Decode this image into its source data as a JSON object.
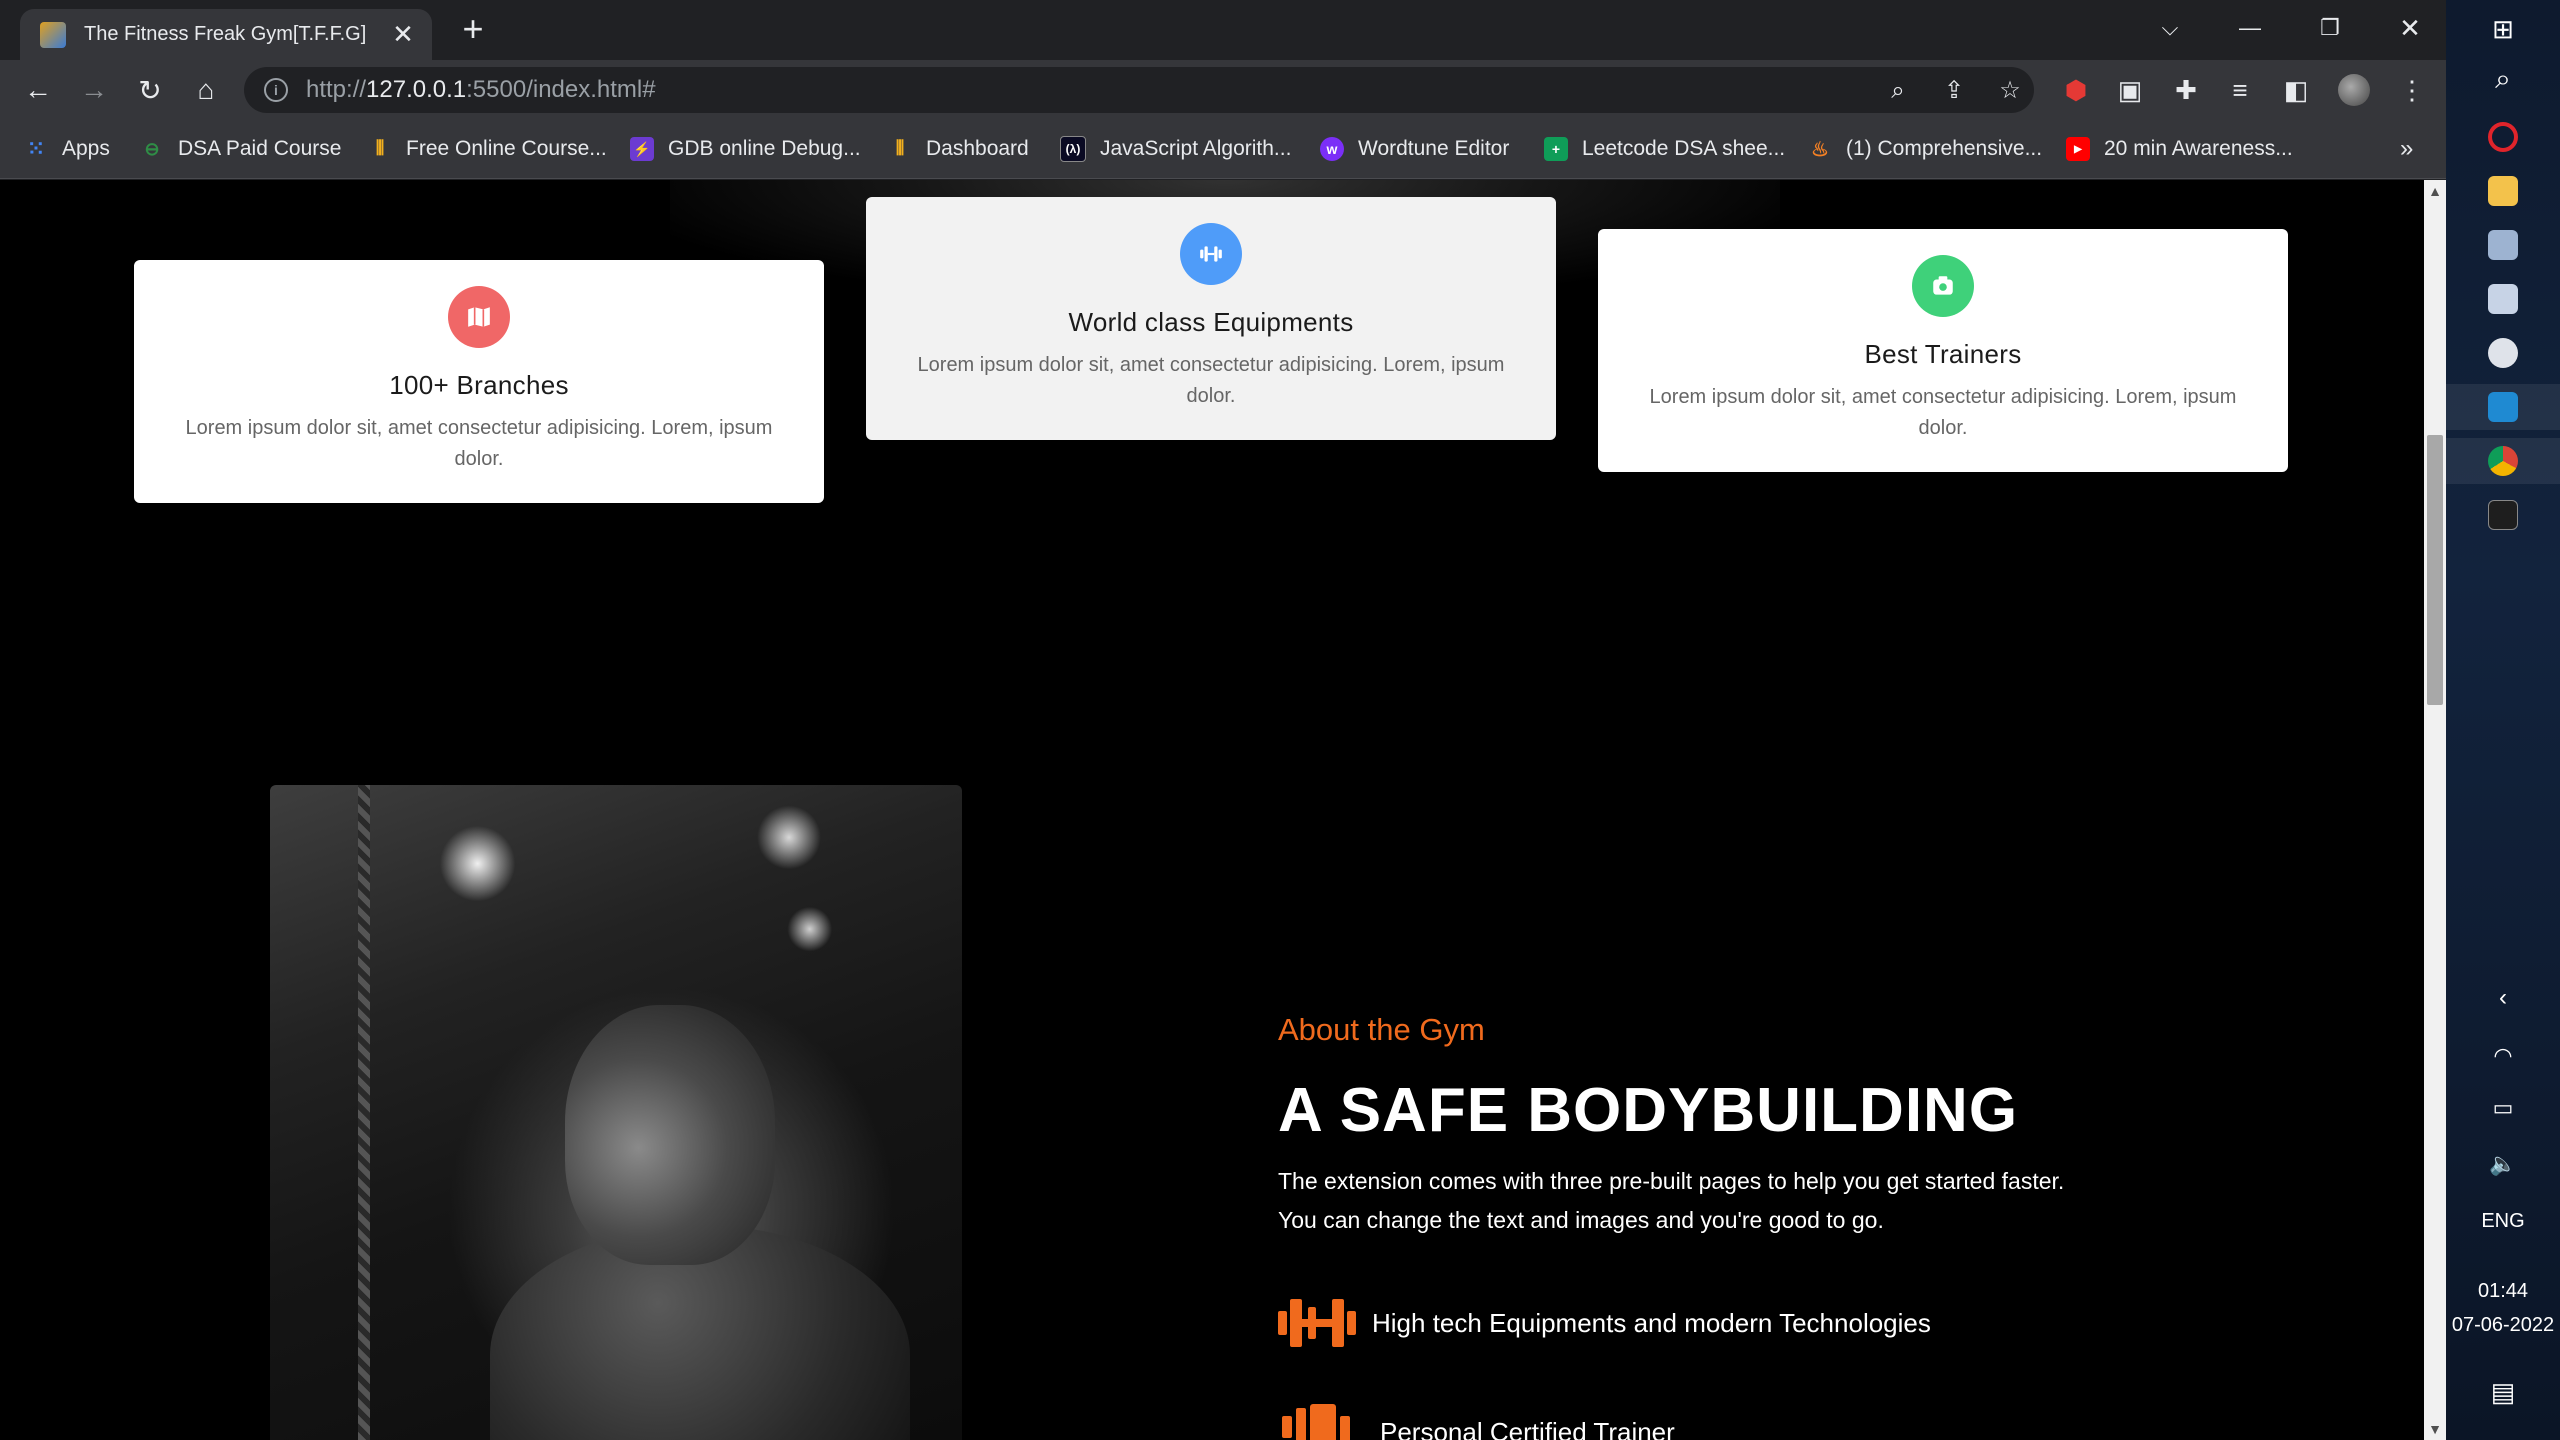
{
  "browser": {
    "tab_title": "The Fitness Freak Gym[T.F.F.G]",
    "url_scheme": "http://",
    "url_host": "127.0.0.1",
    "url_rest": ":5500/index.html#",
    "bookmarks": [
      {
        "label": "Apps",
        "icon": "apps-grid-icon",
        "color": "#4285f4"
      },
      {
        "label": "DSA Paid Course",
        "icon": "gfg-icon",
        "color": "#2f8d46"
      },
      {
        "label": "Free Online Course...",
        "icon": "bars-icon",
        "color": "#f2b01e"
      },
      {
        "label": "GDB online Debug...",
        "icon": "bolt-icon",
        "color": "#6c3bd1"
      },
      {
        "label": "Dashboard",
        "icon": "bars-icon",
        "color": "#f2b01e"
      },
      {
        "label": "JavaScript Algorith...",
        "icon": "freecodecamp-icon",
        "color": "#0a0a23"
      },
      {
        "label": "Wordtune Editor",
        "icon": "wordtune-icon",
        "color": "#7b2ff7"
      },
      {
        "label": "Leetcode DSA shee...",
        "icon": "sheets-icon",
        "color": "#0f9d58"
      },
      {
        "label": "(1) Comprehensive...",
        "icon": "fire-icon",
        "color": "#f48024"
      },
      {
        "label": "20 min Awareness...",
        "icon": "youtube-icon",
        "color": "#ff0000"
      }
    ],
    "more_bookmarks": "»"
  },
  "cards": [
    {
      "title": "100+ Branches",
      "text": "Lorem ipsum dolor sit, amet consectetur adipisicing. Lorem, ipsum dolor.",
      "icon": "map-icon",
      "color": "#f06767"
    },
    {
      "title": "World class Equipments",
      "text": "Lorem ipsum dolor sit, amet consectetur adipisicing. Lorem, ipsum dolor.",
      "icon": "dumbbell-icon",
      "color": "#4f9cf9"
    },
    {
      "title": "Best Trainers",
      "text": "Lorem ipsum dolor sit, amet consectetur adipisicing. Lorem, ipsum dolor.",
      "icon": "camera-icon",
      "color": "#3fd17a"
    }
  ],
  "about": {
    "subtitle": "About the Gym",
    "title": "A SAFE BODYBUILDING",
    "text_line1": "The extension comes with three pre-built pages to help you get started faster.",
    "text_line2": "You can change the text and images and you're good to go.",
    "accent_color": "#f06a1d",
    "features": [
      {
        "label": "High tech Equipments and modern Technologies",
        "icon": "dumbbell-icon"
      },
      {
        "label": "Personal Certified Trainer",
        "icon": "trainer-icon"
      }
    ]
  },
  "taskbar": {
    "language": "ENG",
    "time": "01:44",
    "date": "07-06-2022"
  }
}
